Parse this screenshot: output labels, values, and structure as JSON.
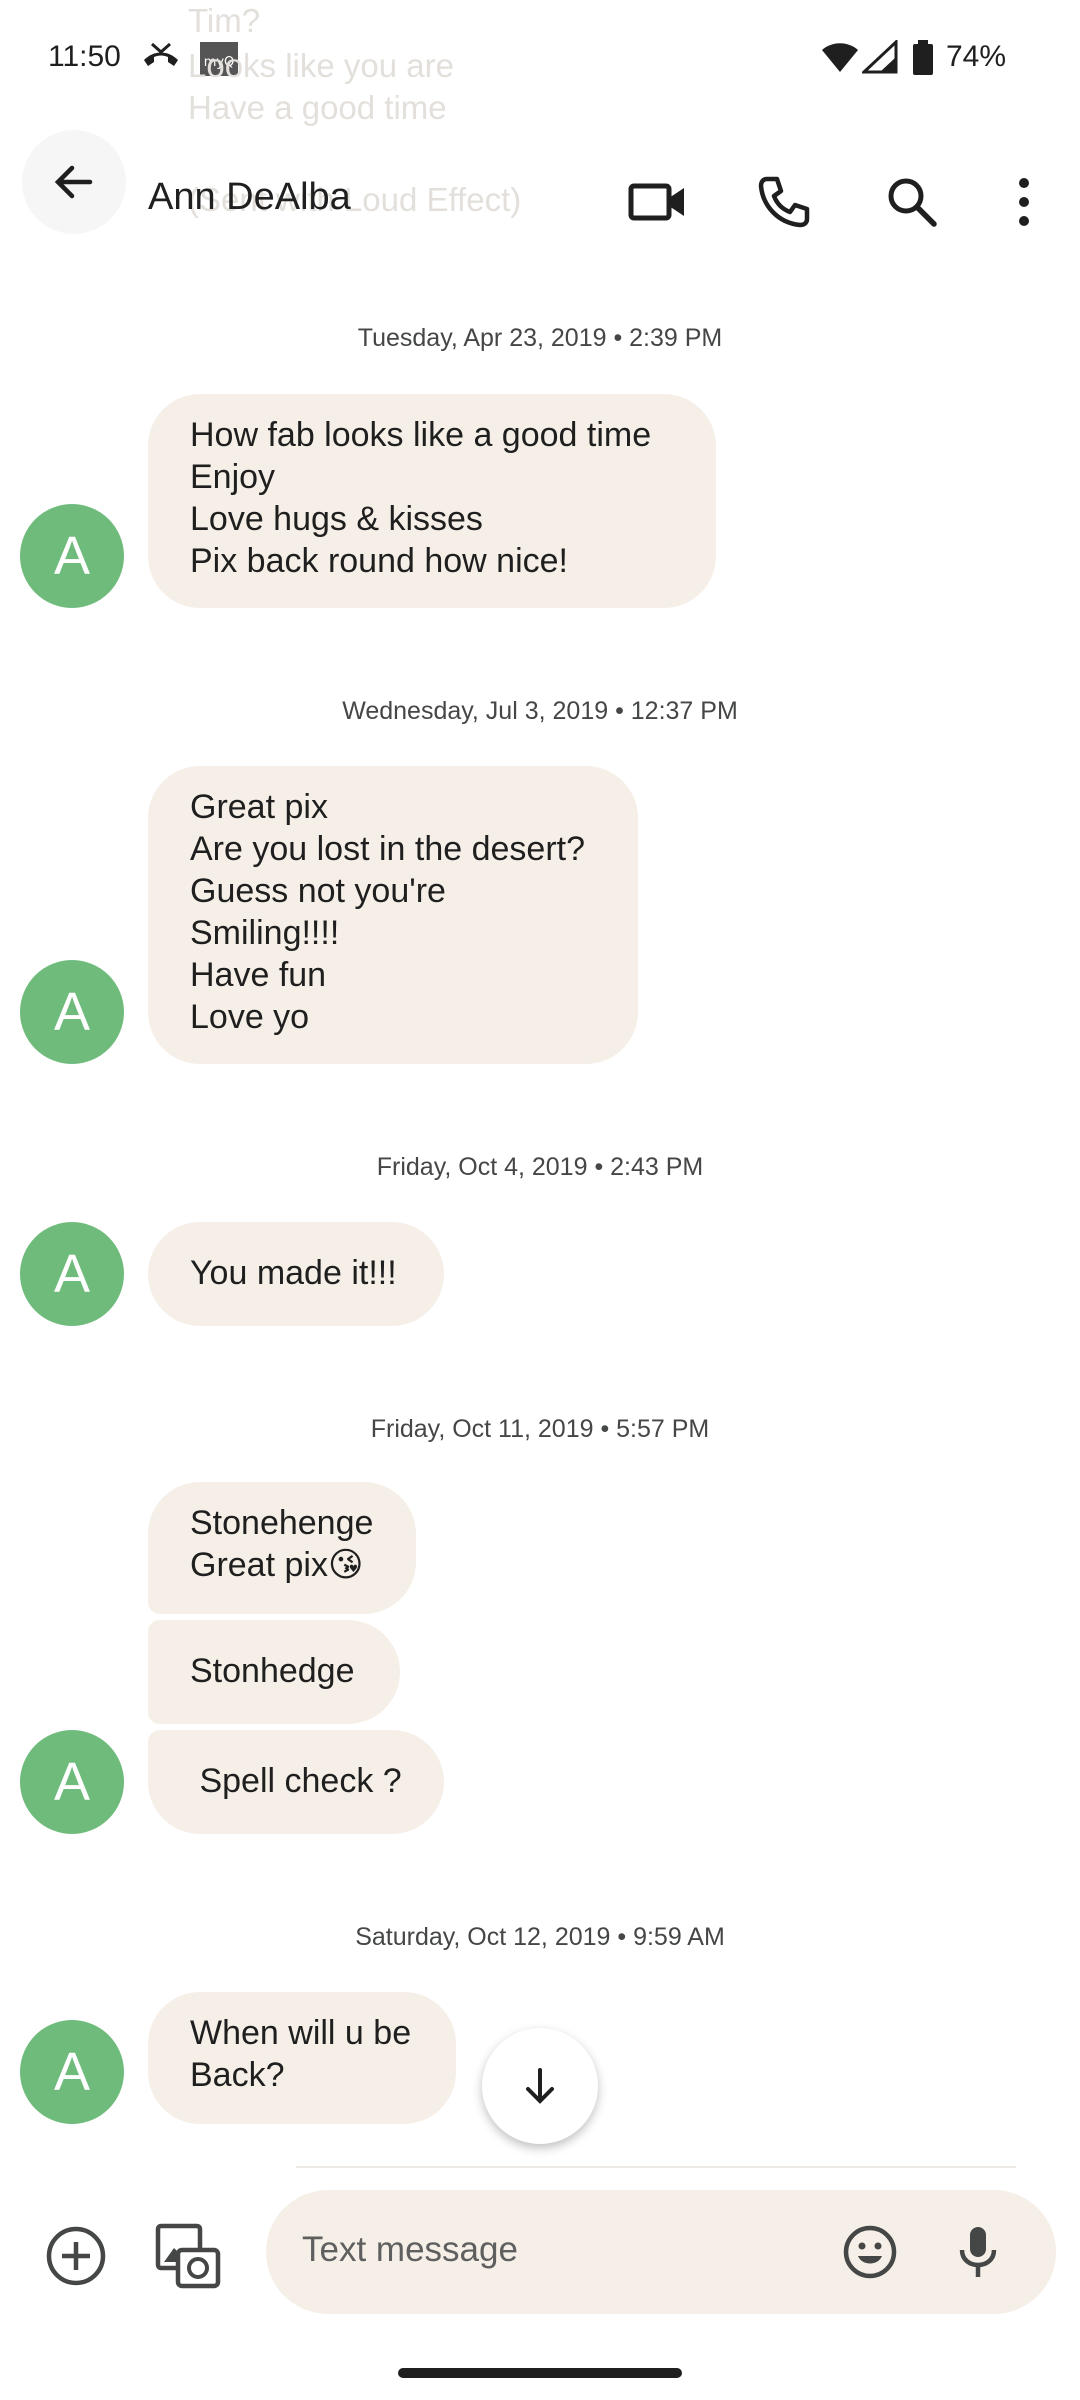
{
  "status_bar": {
    "time": "11:50",
    "battery": "74%",
    "notif_app_label": "myQ",
    "icons": [
      "missed-call-icon",
      "myq-app-icon",
      "wifi-icon",
      "cell-signal-icon",
      "battery-icon"
    ]
  },
  "faded_previous": [
    "Tim?",
    "Looks like you are",
    "Have a good time",
    "(Sent with Loud Effect)"
  ],
  "header": {
    "contact_name": "Ann DeAlba",
    "icons": [
      "back-arrow-icon",
      "video-call-icon",
      "phone-icon",
      "search-icon",
      "more-vert-icon"
    ]
  },
  "avatar_letter": "A",
  "conversation": [
    {
      "timestamp": "Tuesday, Apr 23, 2019 • 2:39 PM",
      "messages": [
        {
          "lines": [
            "How fab looks like a good time",
            "Enjoy",
            "Love hugs & kisses",
            "Pix back round how nice!"
          ]
        }
      ]
    },
    {
      "timestamp": "Wednesday, Jul 3, 2019 • 12:37 PM",
      "messages": [
        {
          "lines": [
            "Great pix",
            "Are you lost in the desert?",
            "Guess not you're",
            "Smiling!!!!",
            "Have fun",
            "Love yo"
          ]
        }
      ]
    },
    {
      "timestamp": "Friday, Oct 4, 2019 • 2:43 PM",
      "messages": [
        {
          "lines": [
            "You made it!!!"
          ]
        }
      ]
    },
    {
      "timestamp": "Friday, Oct 11, 2019 • 5:57 PM",
      "messages": [
        {
          "lines": [
            "Stonehenge",
            "Great pix😘"
          ]
        },
        {
          "lines": [
            "Stonhedge"
          ]
        },
        {
          "lines": [
            " Spell check ?"
          ]
        }
      ]
    },
    {
      "timestamp": "Saturday, Oct 12, 2019 • 9:59 AM",
      "messages": [
        {
          "lines": [
            "When will u be",
            "Back?"
          ]
        }
      ]
    }
  ],
  "composer": {
    "placeholder": "Text message",
    "icons": [
      "add-circle-icon",
      "gallery-icon",
      "emoji-icon",
      "mic-icon"
    ]
  },
  "colors": {
    "bubble": "#f5efe7",
    "avatar": "#6fbb7c",
    "text": "#1f1f1f",
    "timestamp": "#444746"
  }
}
